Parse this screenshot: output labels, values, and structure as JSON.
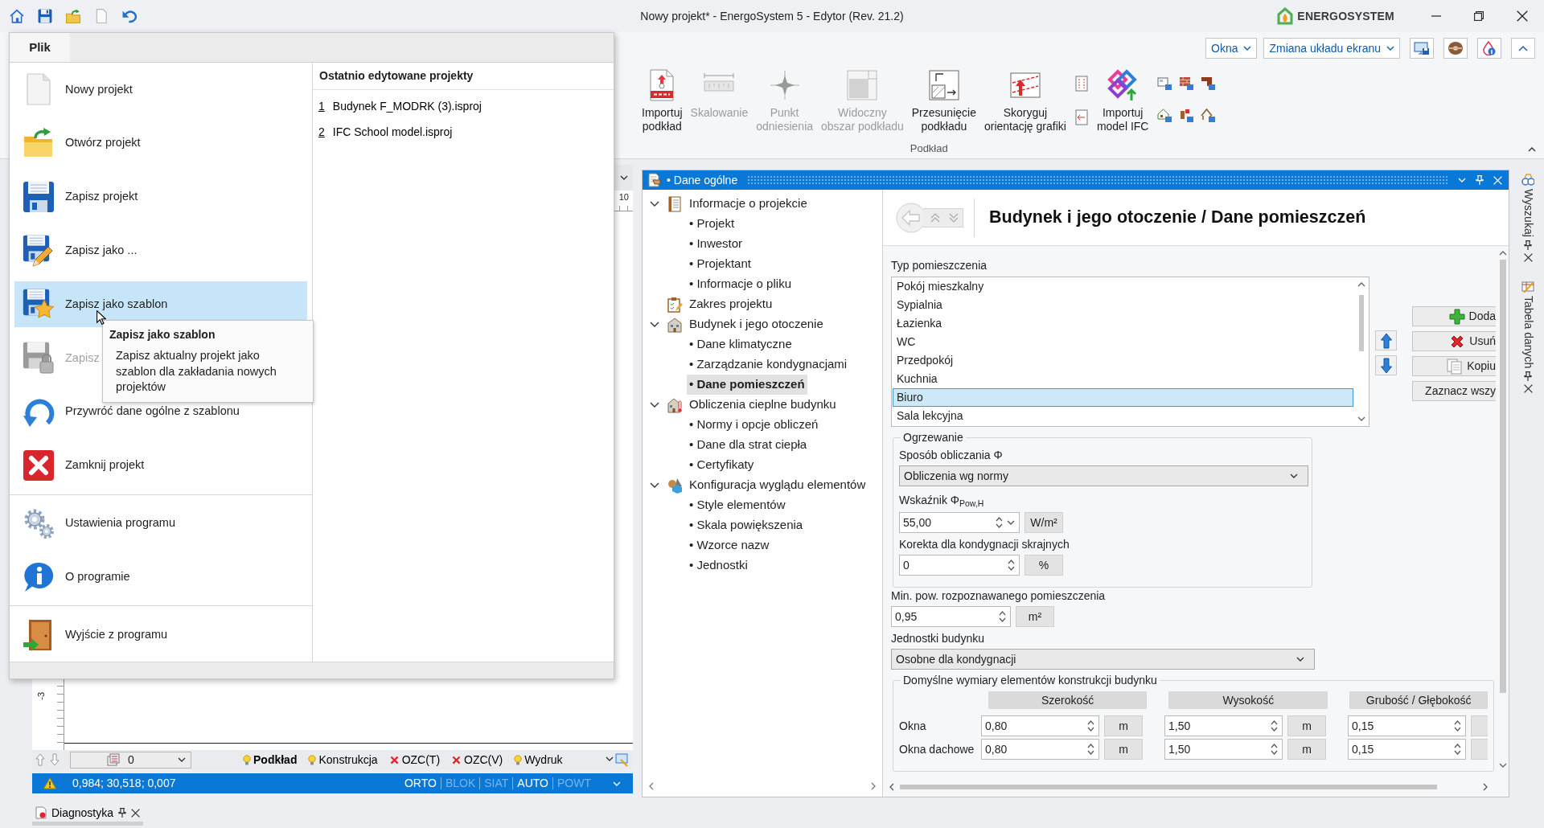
{
  "title_bar": {
    "title": "Nowy projekt* - EnergoSystem 5 - Edytor (Rev. 21.2)",
    "brand": "ENERGOSYSTEM"
  },
  "ribbon": {
    "dropdowns": [
      {
        "label": "Okna"
      },
      {
        "label": "Zmiana układu ekranu"
      }
    ],
    "group": {
      "label": "Podkład",
      "buttons": [
        {
          "kind": "import",
          "label": "Importuj\npodkład",
          "disabled": false
        },
        {
          "kind": "scale",
          "label": "Skalowanie",
          "disabled": true
        },
        {
          "kind": "point",
          "label": "Punkt\nodniesienia",
          "disabled": true
        },
        {
          "kind": "area",
          "label": "Widoczny\nobszar podkładu",
          "disabled": true
        },
        {
          "kind": "shift",
          "label": "Przesunięcie\npodkładu",
          "disabled": false
        },
        {
          "kind": "orient",
          "label": "Skoryguj\norientację grafiki",
          "disabled": false
        },
        {
          "kind": "small_pair"
        },
        {
          "kind": "ifc",
          "label": "Importuj\nmodel IFC",
          "disabled": false
        },
        {
          "kind": "small_grid"
        }
      ]
    }
  },
  "file_menu": {
    "tab": "Plik",
    "groups": [
      [
        {
          "kind": "new",
          "label": "Nowy projekt",
          "selected": false,
          "disabled": false
        },
        {
          "kind": "open",
          "label": "Otwórz projekt",
          "selected": false,
          "disabled": false
        },
        {
          "kind": "save",
          "label": "Zapisz projekt",
          "selected": false,
          "disabled": false
        },
        {
          "kind": "save_as",
          "label": "Zapisz jako ...",
          "selected": false,
          "disabled": false
        },
        {
          "kind": "save_template",
          "label": "Zapisz jako szablon",
          "selected": true,
          "disabled": false
        },
        {
          "kind": "save_locked",
          "label": "Zapisz",
          "selected": false,
          "disabled": true
        },
        {
          "kind": "restore",
          "label": "Przywróć dane ogólne z szablonu",
          "selected": false,
          "disabled": false
        },
        {
          "kind": "close",
          "label": "Zamknij projekt",
          "selected": false,
          "disabled": false
        }
      ],
      [
        {
          "kind": "settings",
          "label": "Ustawienia programu",
          "selected": false,
          "disabled": false
        },
        {
          "kind": "about",
          "label": "O programie",
          "selected": false,
          "disabled": false
        }
      ],
      [
        {
          "kind": "exit",
          "label": "Wyjście z programu",
          "selected": false,
          "disabled": false
        }
      ]
    ],
    "recent": {
      "title": "Ostatnio edytowane projekty",
      "items": [
        {
          "number": "1",
          "name": "Budynek F_MODRK (3).isproj"
        },
        {
          "number": "2",
          "name": "IFC School model.isproj"
        }
      ]
    },
    "tooltip": {
      "title": "Zapisz jako szablon",
      "text": "Zapisz aktualny projekt jako szablon dla zakładania nowych projektów"
    }
  },
  "editor": {
    "top_ruler_label": "10",
    "side_ruler_label": "-3",
    "layer": "0",
    "view_tabs": [
      {
        "label": "Podkład",
        "visible": true,
        "selected": true
      },
      {
        "label": "Konstrukcja",
        "visible": true,
        "selected": false
      },
      {
        "label": "OZC(T)",
        "visible": false,
        "selected": false
      },
      {
        "label": "OZC(V)",
        "visible": false,
        "selected": false
      },
      {
        "label": "Wydruk",
        "visible": true,
        "selected": false
      }
    ],
    "status_bar": {
      "coordinates": "0,984; 30,518; 0,007",
      "modes": [
        {
          "label": "ORTO",
          "on": true
        },
        {
          "label": "BLOK",
          "on": false
        },
        {
          "label": "SIAT",
          "on": false
        },
        {
          "label": "AUTO",
          "on": true
        },
        {
          "label": "POWT",
          "on": false
        }
      ]
    }
  },
  "data_panel": {
    "title": "• Dane ogólne",
    "tree": [
      {
        "kind": "info",
        "label": "Informacje o projekcie",
        "expanded": true,
        "selected": false,
        "children": [
          {
            "label": "• Projekt",
            "selected": false
          },
          {
            "label": "• Inwestor",
            "selected": false
          },
          {
            "label": "• Projektant",
            "selected": false
          },
          {
            "label": "• Informacje o pliku",
            "selected": false
          }
        ]
      },
      {
        "kind": "scope",
        "label": "Zakres projektu",
        "selected": false
      },
      {
        "kind": "building",
        "label": "Budynek i jego otoczenie",
        "expanded": true,
        "selected": false,
        "children": [
          {
            "label": "• Dane klimatyczne",
            "selected": false
          },
          {
            "label": "• Zarządzanie kondygnacjami",
            "selected": false
          },
          {
            "label": "• Dane pomieszczeń",
            "selected": true
          }
        ]
      },
      {
        "kind": "thermal",
        "label": "Obliczenia cieplne budynku",
        "expanded": true,
        "selected": false,
        "children": [
          {
            "label": "• Normy i opcje obliczeń",
            "selected": false
          },
          {
            "label": "• Dane dla strat ciepła",
            "selected": false
          },
          {
            "label": "• Certyfikaty",
            "selected": false
          }
        ]
      },
      {
        "kind": "appearance",
        "label": "Konfiguracja wyglądu elementów",
        "expanded": true,
        "selected": false,
        "children": [
          {
            "label": "• Style elementów",
            "selected": false
          },
          {
            "label": "• Skala powiększenia",
            "selected": false
          },
          {
            "label": "• Wzorce nazw",
            "selected": false
          },
          {
            "label": "• Jednostki",
            "selected": false
          }
        ]
      }
    ],
    "page_title": "Budynek i jego otoczenie / Dane pomieszczeń",
    "room_types": {
      "label": "Typ pomieszczenia",
      "items": [
        {
          "name": "Pokój mieszkalny",
          "selected": false
        },
        {
          "name": "Sypialnia",
          "selected": false
        },
        {
          "name": "Łazienka",
          "selected": false
        },
        {
          "name": "WC",
          "selected": false
        },
        {
          "name": "Przedpokój",
          "selected": false
        },
        {
          "name": "Kuchnia",
          "selected": false
        },
        {
          "name": "Biuro",
          "selected": true
        },
        {
          "name": "Sala lekcyjna",
          "selected": false
        }
      ]
    },
    "room_buttons": [
      {
        "kind": "add",
        "label": "Doda"
      },
      {
        "kind": "remove",
        "label": "Usuń"
      },
      {
        "kind": "copy",
        "label": "Kopiu"
      },
      {
        "kind": "plain",
        "label": "Zaznacz wszy"
      }
    ],
    "heating": {
      "legend": "Ogrzewanie",
      "method_label": "Sposób obliczania Φ",
      "method": "Obliczenia wg normy",
      "indicator_label": "Wskaźnik Φ$_{Pow,H}$",
      "indicator": {
        "value": "55,00",
        "unit": "W/m²",
        "dropdown": true
      },
      "correction_label": "Korekta dla kondygnacji skrajnych",
      "correction": {
        "value": "0",
        "unit": "%"
      }
    },
    "min_area": {
      "label": "Min. pow. rozpoznawanego pomieszczenia",
      "value": "0,95",
      "unit": "m²"
    },
    "building_units": {
      "label": "Jednostki budynku",
      "value": "Osobne dla kondygnacji"
    },
    "default_dimensions": {
      "legend": "Domyślne wymiary elementów konstrukcji budynku",
      "columns": [
        "Szerokość",
        "Wysokość",
        "Grubość / Głębokość"
      ],
      "rows": [
        {
          "label": "Okna",
          "cells": [
            {
              "value": "0,80",
              "unit": "m"
            },
            {
              "value": "1,50",
              "unit": "m"
            },
            {
              "value": "0,15"
            }
          ]
        },
        {
          "label": "Okna dachowe",
          "cells": [
            {
              "value": "0,80",
              "unit": "m"
            },
            {
              "value": "1,50",
              "unit": "m"
            },
            {
              "value": "0,15"
            }
          ]
        }
      ]
    }
  },
  "side_tabs": [
    {
      "kind": "search",
      "label": "Wyszukaj"
    },
    {
      "kind": "table",
      "label": "Tabela danych"
    }
  ],
  "bottom_tabs": [
    {
      "label": "Diagnostyka"
    }
  ]
}
